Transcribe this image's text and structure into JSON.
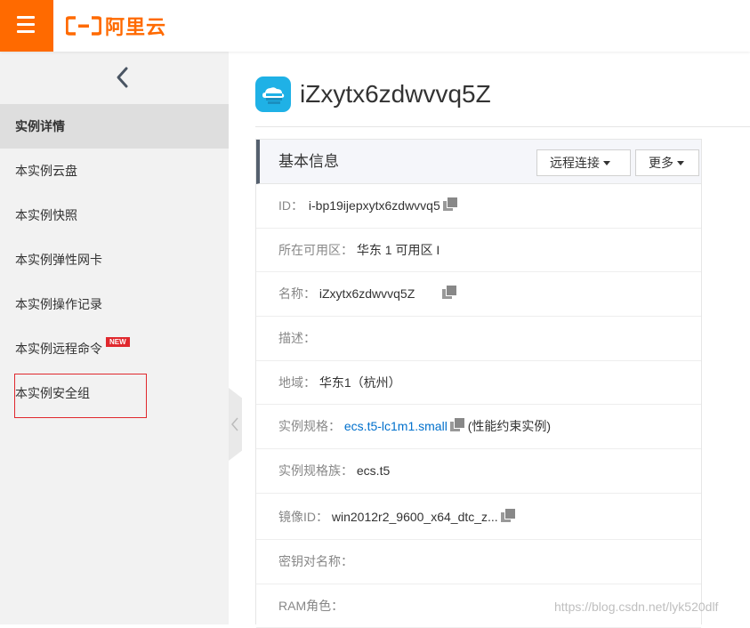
{
  "brand": {
    "name": "阿里云",
    "color": "#ff6a00"
  },
  "sidebar": {
    "items": [
      {
        "label": "实例详情",
        "active": true
      },
      {
        "label": "本实例云盘"
      },
      {
        "label": "本实例快照"
      },
      {
        "label": "本实例弹性网卡"
      },
      {
        "label": "本实例操作记录"
      },
      {
        "label": "本实例远程命令",
        "badge": "NEW"
      },
      {
        "label": "本实例安全组",
        "highlighted": true
      }
    ]
  },
  "instance": {
    "title": "iZxytx6zdwvvq5Z"
  },
  "panel": {
    "title": "基本信息",
    "remote_label": "远程连接",
    "more_label": "更多",
    "rows": {
      "id": {
        "key": "ID：",
        "value": "i-bp19ijepxytx6zdwvvq5"
      },
      "zone": {
        "key": "所在可用区：",
        "value": "华东 1 可用区 I"
      },
      "name": {
        "key": "名称：",
        "value": "iZxytx6zdwvvq5Z"
      },
      "desc": {
        "key": "描述：",
        "value": ""
      },
      "region": {
        "key": "地域：",
        "value": "华东1（杭州）"
      },
      "spec": {
        "key": "实例规格：",
        "link": "ecs.t5-lc1m1.small",
        "extra": "(性能约束实例)"
      },
      "family": {
        "key": "实例规格族：",
        "value": "ecs.t5"
      },
      "image": {
        "key": "镜像ID：",
        "value": "win2012r2_9600_x64_dtc_z..."
      },
      "keypair": {
        "key": "密钥对名称：",
        "value": ""
      },
      "ram": {
        "key": "RAM角色：",
        "value": ""
      }
    }
  },
  "watermark": "https://blog.csdn.net/lyk520dlf"
}
